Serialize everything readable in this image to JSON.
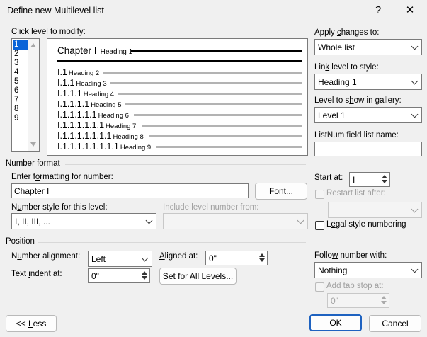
{
  "window": {
    "title": "Define new Multilevel list",
    "help": "?",
    "close": "✕"
  },
  "levels": {
    "label_pre": "Click le",
    "label_u": "v",
    "label_post": "el to modify:",
    "items": [
      "1",
      "2",
      "3",
      "4",
      "5",
      "6",
      "7",
      "8",
      "9"
    ],
    "selected": "1"
  },
  "preview": {
    "top": {
      "num": "Chapter I",
      "heading": "Heading 1"
    },
    "rows": [
      {
        "num": "I.1",
        "heading": "Heading 2"
      },
      {
        "num": "I.1.1",
        "heading": "Heading 3"
      },
      {
        "num": "I.1.1.1",
        "heading": "Heading 4"
      },
      {
        "num": "I.1.1.1.1",
        "heading": "Heading 5"
      },
      {
        "num": "I.1.1.1.1.1",
        "heading": "Heading 6"
      },
      {
        "num": "I.1.1.1.1.1.1",
        "heading": "Heading 7"
      },
      {
        "num": "I.1.1.1.1.1.1.1",
        "heading": "Heading 8"
      },
      {
        "num": "I.1.1.1.1.1.1.1.1",
        "heading": "Heading 9"
      }
    ]
  },
  "apply": {
    "label_pre": "Apply ",
    "label_u": "c",
    "label_post": "hanges to:",
    "value": "Whole list"
  },
  "link": {
    "label_pre": "Lin",
    "label_u": "k",
    "label_post": " level to style:",
    "value": "Heading 1"
  },
  "gallery": {
    "label_pre": "Level to s",
    "label_u": "h",
    "label_post": "ow in gallery:",
    "value": "Level 1"
  },
  "listnum": {
    "label": "ListNum field list name:",
    "value": ""
  },
  "number_format": {
    "section": "Number format",
    "enter_label_pre": "Enter f",
    "enter_label_u": "o",
    "enter_label_post": "rmatting for number:",
    "value": "Chapter I",
    "font_button": "Font...",
    "style_label_pre": "N",
    "style_label_u": "u",
    "style_label_post": "mber style for this level:",
    "style_value": "I, II, III, ...",
    "include_label": "Include level number from:",
    "include_value": "",
    "start_label_pre": "St",
    "start_label_u": "a",
    "start_label_post": "rt at:",
    "start_value": "I",
    "restart_label": "Restart list after:",
    "restart_value": "",
    "legal_label_pre": "L",
    "legal_label_u": "e",
    "legal_label_post": "gal style numbering"
  },
  "position": {
    "section": "Position",
    "align_label_pre": "N",
    "align_label_u": "u",
    "align_label_post": "mber alignment:",
    "align_value": "Left",
    "aligned_label_pre": "",
    "aligned_label_u": "A",
    "aligned_label_post": "ligned at:",
    "aligned_value": "0\"",
    "indent_label_pre": "Text ",
    "indent_label_u": "i",
    "indent_label_post": "ndent at:",
    "indent_value": "0\"",
    "set_all_button_pre": "",
    "set_all_button_u": "S",
    "set_all_button_post": "et for All Levels...",
    "follow_label_pre": "Follo",
    "follow_label_u": "w",
    "follow_label_post": " number with:",
    "follow_value": "Nothing",
    "tabstop_label": "Add tab stop at:",
    "tabstop_value": "0\""
  },
  "footer": {
    "less_pre": "<< ",
    "less_u": "L",
    "less_post": "ess",
    "ok": "OK",
    "cancel": "Cancel"
  }
}
